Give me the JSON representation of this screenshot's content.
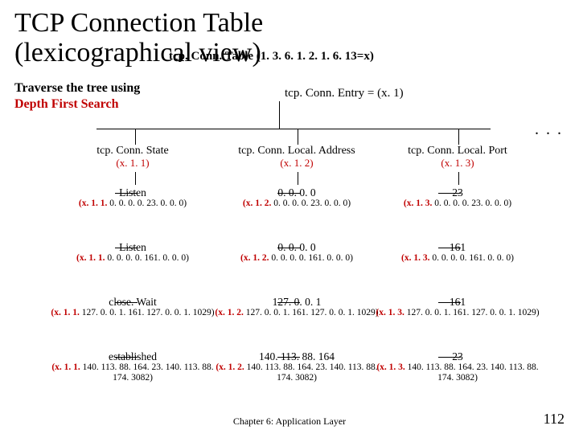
{
  "title_line1": "TCP Connection Table",
  "title_line2": "(lexicographical view)",
  "overlay_top": "tcp. Conn. Table (1. 3. 6. 1. 2. 1. 6. 13=x)",
  "traverse_line1": "Traverse the tree using",
  "traverse_line2": "Depth First Search",
  "entry_label": "tcp. Conn. Entry = (x. 1)",
  "dots": ". . .",
  "columns": [
    {
      "name": "tcp. Conn. State",
      "oid": "(x. 1. 1)"
    },
    {
      "name": "tcp. Conn. Local. Address",
      "oid": "(x. 1. 2)"
    },
    {
      "name": "tcp. Conn. Local. Port",
      "oid": "(x. 1. 3)"
    }
  ],
  "rows": [
    {
      "c1_main": "Listen",
      "c1_pre": "(x. 1. 1.",
      "c1_rest": " 0. 0. 0. 0. 23. 0. 0. 0)",
      "c2_main": "0. 0. 0. 0",
      "c2_pre": "(x. 1. 2.",
      "c2_rest": " 0. 0. 0. 0. 23. 0. 0. 0)",
      "c3_main": "23",
      "c3_pre": "(x. 1. 3.",
      "c3_rest": " 0. 0. 0. 0. 23. 0. 0. 0)"
    },
    {
      "c1_main": "Listen",
      "c1_pre": "(x. 1. 1.",
      "c1_rest": " 0. 0. 0. 0. 161. 0. 0. 0)",
      "c2_main": "0. 0. 0. 0",
      "c2_pre": "(x. 1. 2.",
      "c2_rest": " 0. 0. 0. 0. 161. 0. 0. 0)",
      "c3_main": "161",
      "c3_pre": "(x. 1. 3.",
      "c3_rest": " 0. 0. 0. 0. 161. 0. 0. 0)"
    },
    {
      "c1_main": "close. Wait",
      "c1_pre": "(x. 1. 1.",
      "c1_rest": " 127. 0. 0. 1. 161. 127. 0. 0. 1. 1029)",
      "c2_main": "127. 0. 0. 1",
      "c2_pre": "(x. 1. 2.",
      "c2_rest": " 127. 0. 0. 1. 161. 127. 0. 0. 1. 1029)",
      "c3_main": "161",
      "c3_pre": "(x. 1. 3.",
      "c3_rest": " 127. 0. 0. 1. 161. 127. 0. 0. 1. 1029)"
    },
    {
      "c1_main": "established",
      "c1_pre": "(x. 1. 1.",
      "c1_rest": " 140. 113. 88. 164. 23. 140. 113. 88. 174. 3082)",
      "c2_main": "140. 113. 88. 164",
      "c2_pre": "(x. 1. 2.",
      "c2_rest": " 140. 113. 88. 164. 23. 140. 113. 88. 174. 3082)",
      "c3_main": "23",
      "c3_pre": "(x. 1. 3.",
      "c3_rest": " 140. 113. 88. 164. 23. 140. 113. 88. 174. 3082)"
    }
  ],
  "footer_left": "Chapter 6: Application Layer",
  "footer_right": "112"
}
